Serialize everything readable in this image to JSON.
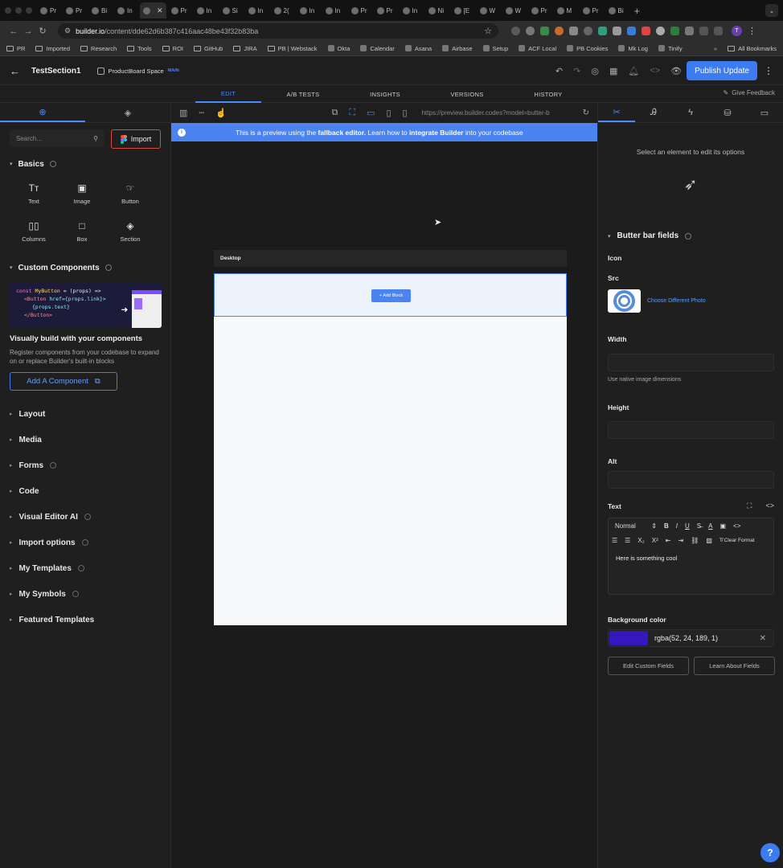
{
  "browser": {
    "tabs": [
      {
        "label": "Pr",
        "active": false
      },
      {
        "label": "Pr",
        "active": false
      },
      {
        "label": "Bi",
        "active": false
      },
      {
        "label": "In",
        "active": false
      },
      {
        "label": "",
        "active": true
      },
      {
        "label": "Pr",
        "active": false
      },
      {
        "label": "In",
        "active": false
      },
      {
        "label": "Si",
        "active": false
      },
      {
        "label": "In",
        "active": false
      },
      {
        "label": "2(",
        "active": false
      },
      {
        "label": "In",
        "active": false
      },
      {
        "label": "In",
        "active": false
      },
      {
        "label": "Pr",
        "active": false
      },
      {
        "label": "Pr",
        "active": false
      },
      {
        "label": "In",
        "active": false
      },
      {
        "label": "Ni",
        "active": false
      },
      {
        "label": "[E",
        "active": false
      },
      {
        "label": "W",
        "active": false
      },
      {
        "label": "W",
        "active": false
      },
      {
        "label": "Pr",
        "active": false
      },
      {
        "label": "M",
        "active": false
      },
      {
        "label": "Pr",
        "active": false
      },
      {
        "label": "Bi",
        "active": false
      }
    ],
    "url_host": "builder.io",
    "url_path": "/content/dde62d6b387c416aac48be43f32b83ba",
    "profile_initial": "T",
    "bookmarks": [
      {
        "label": "PR",
        "type": "folder"
      },
      {
        "label": "Imported",
        "type": "folder"
      },
      {
        "label": "Research",
        "type": "folder"
      },
      {
        "label": "Tools",
        "type": "folder"
      },
      {
        "label": "ROI",
        "type": "folder"
      },
      {
        "label": "GitHub",
        "type": "folder"
      },
      {
        "label": "JIRA",
        "type": "folder"
      },
      {
        "label": "PB | Webstack",
        "type": "folder"
      },
      {
        "label": "Okta",
        "type": "site"
      },
      {
        "label": "Calendar",
        "type": "site"
      },
      {
        "label": "Asana",
        "type": "site"
      },
      {
        "label": "Airbase",
        "type": "site"
      },
      {
        "label": "Setup",
        "type": "site"
      },
      {
        "label": "ACF Local",
        "type": "site"
      },
      {
        "label": "PB Cookies",
        "type": "site"
      },
      {
        "label": "Mk Log",
        "type": "site"
      },
      {
        "label": "Tinify",
        "type": "site"
      }
    ],
    "all_bookmarks": "All Bookmarks"
  },
  "header": {
    "title": "TestSection1",
    "space_name": "ProductBoard Space",
    "space_badge": "MAIN",
    "publish_label": "Publish Update"
  },
  "mode_tabs": [
    "EDIT",
    "A/B TESTS",
    "INSIGHTS",
    "VERSIONS",
    "HISTORY"
  ],
  "active_mode": "EDIT",
  "give_feedback": "Give Feedback",
  "left": {
    "search_placeholder": "Search...",
    "import_label": "Import",
    "basics_title": "Basics",
    "blocks": [
      {
        "label": "Text",
        "icon": "text-icon",
        "glyph": "Tт"
      },
      {
        "label": "Image",
        "icon": "image-icon",
        "glyph": "▣"
      },
      {
        "label": "Button",
        "icon": "button-icon",
        "glyph": "☞"
      },
      {
        "label": "Columns",
        "icon": "columns-icon",
        "glyph": "▯▯"
      },
      {
        "label": "Box",
        "icon": "box-icon",
        "glyph": "□"
      },
      {
        "label": "Section",
        "icon": "section-icon",
        "glyph": "◈"
      }
    ],
    "custom_components_title": "Custom Components",
    "code_lines": {
      "l1_kw": "const",
      "l1_fn": "MyButton",
      "l1_rest": " = (props) =>",
      "l2_tag": "<Button",
      "l2_attr": " href={props.link}>",
      "l3": "{props.text}",
      "l4": "</Button>"
    },
    "visual_title": "Visually build with your components",
    "visual_text": "Register components from your codebase to expand on or replace Builder's built-in blocks",
    "add_component_label": "Add A Component",
    "accordions": [
      {
        "label": "Layout",
        "info": false
      },
      {
        "label": "Media",
        "info": false
      },
      {
        "label": "Forms",
        "info": true
      },
      {
        "label": "Code",
        "info": false
      },
      {
        "label": "Visual Editor AI",
        "info": true
      },
      {
        "label": "Import options",
        "info": true
      },
      {
        "label": "My Templates",
        "info": true
      },
      {
        "label": "My Symbols",
        "info": true
      },
      {
        "label": "Featured Templates",
        "info": false
      }
    ]
  },
  "canvas": {
    "preview_url": "https://preview.builder.codes?model=butter-b",
    "banner_prefix": "This is a preview using the ",
    "banner_bold1": "fallback editor.",
    "banner_mid": " Learn how to ",
    "banner_bold2": "integrate Builder",
    "banner_suffix": " into your codebase",
    "device_label": "Desktop",
    "add_block_label": "+ Add Block"
  },
  "right": {
    "select_msg": "Select an element to edit its options",
    "section_title": "Butter bar fields",
    "icon_label": "Icon",
    "src_label": "Src",
    "choose_photo": "Choose Different Photo",
    "width_label": "Width",
    "width_hint": "Use native image dimensions",
    "height_label": "Height",
    "alt_label": "Alt",
    "text_label": "Text",
    "text_style": "Normal",
    "clear_format": "Clear Format",
    "text_content": "Here is something cool",
    "bg_label": "Background color",
    "bg_value": "rgba(52, 24, 189, 1)",
    "bg_color": "#3418bd",
    "edit_fields": "Edit Custom Fields",
    "learn_fields": "Learn About Fields"
  },
  "colors": {
    "accent": "#3d7cf0",
    "banner": "#4b84f0",
    "import_border": "#d9473d"
  }
}
